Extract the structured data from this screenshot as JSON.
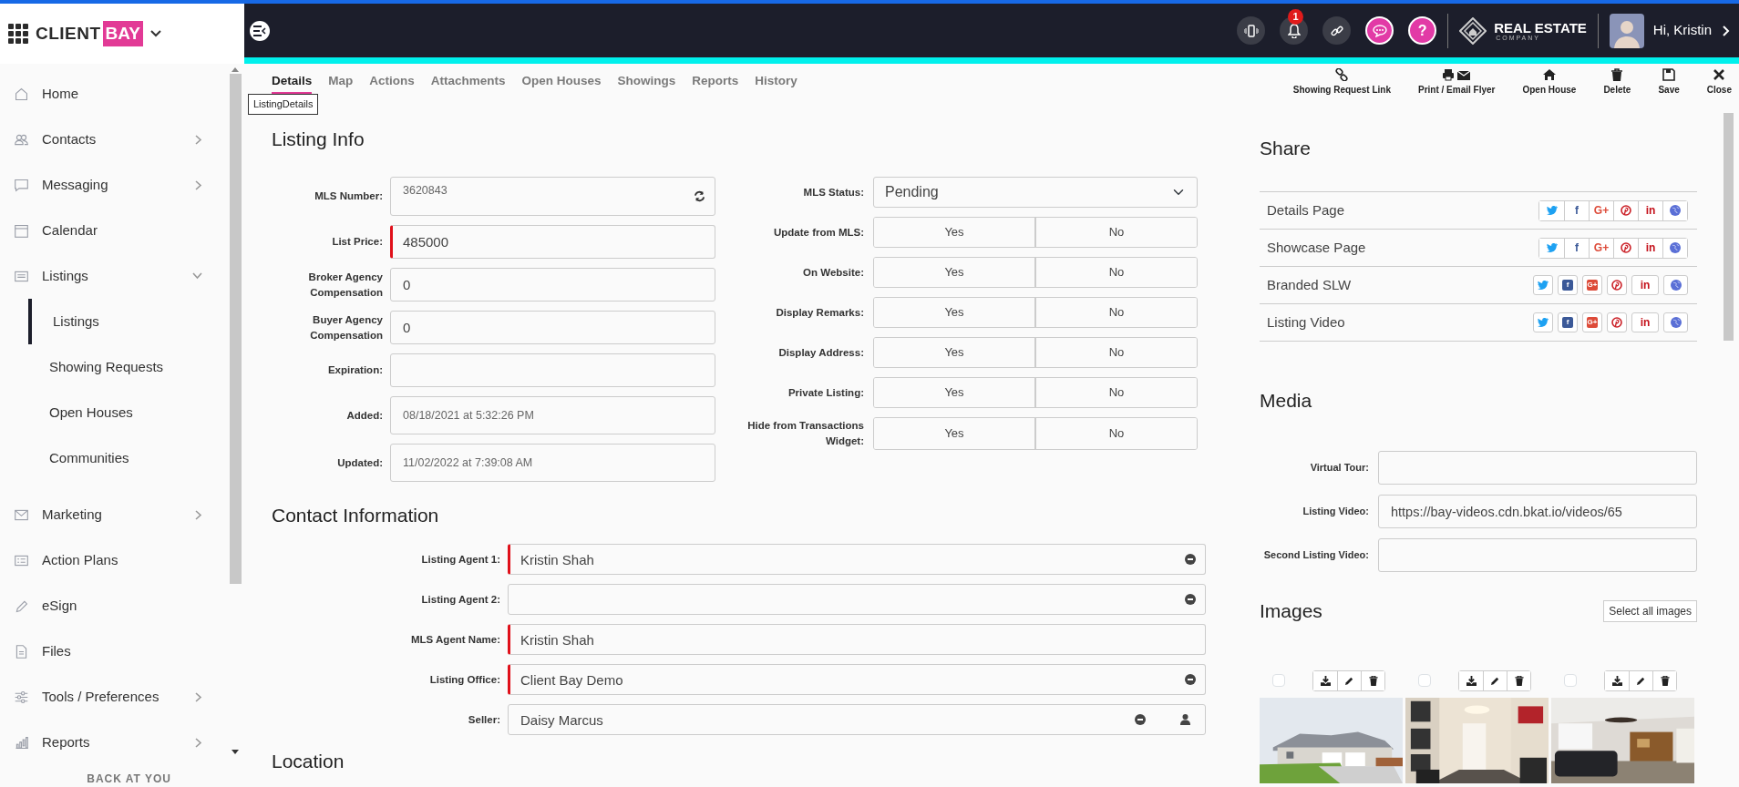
{
  "brand": {
    "name": "CLIENT",
    "highlight": "BAY"
  },
  "header": {
    "badge": "1",
    "help": "?",
    "company": [
      "REAL ESTATE",
      "COMPANY"
    ],
    "greeting": "Hi, Kristin"
  },
  "sidebar": {
    "items": [
      {
        "label": "Home"
      },
      {
        "label": "Contacts",
        "expanded": false
      },
      {
        "label": "Messaging",
        "expanded": false
      },
      {
        "label": "Calendar"
      },
      {
        "label": "Listings",
        "expanded": true,
        "children": [
          {
            "label": "Listings",
            "selected": true
          },
          {
            "label": "Showing Requests",
            "selected": false
          },
          {
            "label": "Open Houses",
            "selected": false
          },
          {
            "label": "Communities",
            "selected": false
          }
        ]
      },
      {
        "label": "Marketing",
        "expanded": false
      },
      {
        "label": "Action Plans"
      },
      {
        "label": "eSign"
      },
      {
        "label": "Files"
      },
      {
        "label": "Tools / Preferences",
        "expanded": false
      },
      {
        "label": "Reports",
        "expanded": false
      }
    ],
    "footer": "BACK AT YOU"
  },
  "tabs": [
    {
      "label": "Details",
      "selected": true
    },
    {
      "label": "Map",
      "selected": false
    },
    {
      "label": "Actions",
      "selected": false
    },
    {
      "label": "Attachments",
      "selected": false
    },
    {
      "label": "Open Houses",
      "selected": false
    },
    {
      "label": "Showings",
      "selected": false
    },
    {
      "label": "Reports",
      "selected": false
    },
    {
      "label": "History",
      "selected": false
    }
  ],
  "tooltip": "ListingDetails",
  "toolbar": [
    "Showing Request Link",
    "Print / Email Flyer",
    "Open House",
    "Delete",
    "Save",
    "Close"
  ],
  "listing_info": {
    "title": "Listing Info",
    "fields": [
      {
        "label": "MLS Number:",
        "value": "3620843",
        "kind": "mls",
        "required": false
      },
      {
        "label": "List Price:",
        "value": "485000",
        "kind": "text",
        "required": true
      },
      {
        "label": "Broker Agency Compensation",
        "value": "0",
        "kind": "text",
        "required": false
      },
      {
        "label": "Buyer Agency Compensation",
        "value": "0",
        "kind": "text",
        "required": false
      },
      {
        "label": "Expiration:",
        "kind": "text",
        "required": false
      },
      {
        "label": "Added:",
        "value": "08/18/2021 at 5:32:26 PM",
        "kind": "readonly",
        "required": false
      },
      {
        "label": "Updated:",
        "value": "11/02/2022 at 7:39:08 AM",
        "kind": "readonly",
        "required": false
      }
    ],
    "settings": [
      {
        "label": "MLS Status:",
        "kind": "select",
        "value": "Pending"
      },
      {
        "label": "Update from MLS:",
        "kind": "toggle",
        "options": [
          "Yes",
          "No"
        ]
      },
      {
        "label": "On Website:",
        "kind": "toggle",
        "options": [
          "Yes",
          "No"
        ]
      },
      {
        "label": "Display Remarks:",
        "kind": "toggle",
        "options": [
          "Yes",
          "No"
        ]
      },
      {
        "label": "Display Address:",
        "kind": "toggle",
        "options": [
          "Yes",
          "No"
        ]
      },
      {
        "label": "Private Listing:",
        "kind": "toggle",
        "options": [
          "Yes",
          "No"
        ]
      },
      {
        "label": "Hide from Transactions Widget:",
        "kind": "toggle",
        "options": [
          "Yes",
          "No"
        ]
      }
    ]
  },
  "contact": {
    "title": "Contact Information",
    "fields": [
      {
        "label": "Listing Agent 1:",
        "value": "Kristin Shah",
        "kind": "removable",
        "required": true
      },
      {
        "label": "Listing Agent 2:",
        "kind": "removable",
        "required": false
      },
      {
        "label": "MLS Agent Name:",
        "value": "Kristin Shah",
        "kind": "text",
        "required": true
      },
      {
        "label": "Listing Office:",
        "value": "Client Bay Demo",
        "kind": "removable",
        "required": true
      },
      {
        "label": "Seller:",
        "value": "Daisy Marcus",
        "kind": "person",
        "required": false
      }
    ]
  },
  "location": {
    "title": "Location"
  },
  "share": {
    "title": "Share",
    "rows": [
      {
        "label": "Details Page",
        "kind": "plain",
        "letters": [
          "f",
          "G+",
          "in"
        ]
      },
      {
        "label": "Showcase Page",
        "kind": "plain",
        "letters": [
          "f",
          "G+",
          "in"
        ]
      },
      {
        "label": "Branded SLW",
        "kind": "boxed",
        "letters": [
          "f",
          "G+",
          "in"
        ]
      },
      {
        "label": "Listing Video",
        "kind": "boxed",
        "letters": [
          "f",
          "G+",
          "in"
        ]
      }
    ]
  },
  "media": {
    "title": "Media",
    "fields": [
      {
        "label": "Virtual Tour:"
      },
      {
        "label": "Listing Video:",
        "value": "https://bay-videos.cdn.bkat.io/videos/65"
      },
      {
        "label": "Second Listing Video:"
      }
    ]
  },
  "images": {
    "title": "Images",
    "select_all": "Select all images"
  }
}
